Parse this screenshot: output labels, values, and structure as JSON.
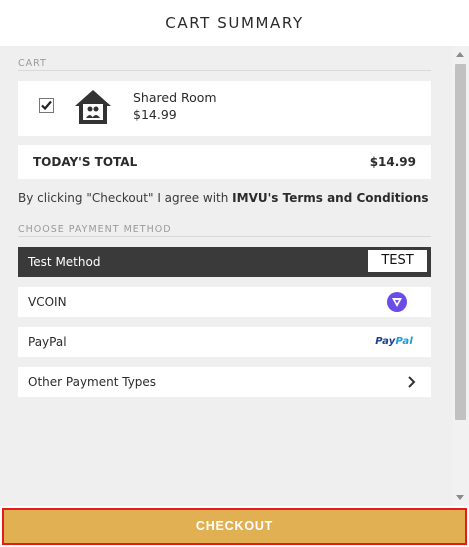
{
  "header": {
    "title": "CART SUMMARY"
  },
  "cart": {
    "section_label": "CART",
    "item": {
      "name": "Shared Room",
      "price": "$14.99",
      "checked": true,
      "icon": "house-icon"
    }
  },
  "total": {
    "label": "TODAY'S TOTAL",
    "value": "$14.99"
  },
  "agreement": {
    "prefix": "By clicking \"Checkout\" I agree with ",
    "link": "IMVU's Terms and Conditions"
  },
  "payment": {
    "section_label": "CHOOSE PAYMENT METHOD",
    "methods": [
      {
        "label": "Test Method",
        "badge": "TEST",
        "selected": true
      },
      {
        "label": "VCOIN",
        "icon": "vcoin-icon"
      },
      {
        "label": "PayPal",
        "logo_text_a": "Pay",
        "logo_text_b": "Pal"
      },
      {
        "label": "Other Payment Types",
        "icon": "chevron-right-icon"
      }
    ]
  },
  "footer": {
    "checkout_label": "CHECKOUT"
  },
  "colors": {
    "selected_bg": "#3a3a3a",
    "checkout_bg": "#e1b053",
    "highlight_border": "#e21b1b",
    "vcoin_purple": "#6b4de6",
    "paypal_blue": "#1d3f8e"
  }
}
